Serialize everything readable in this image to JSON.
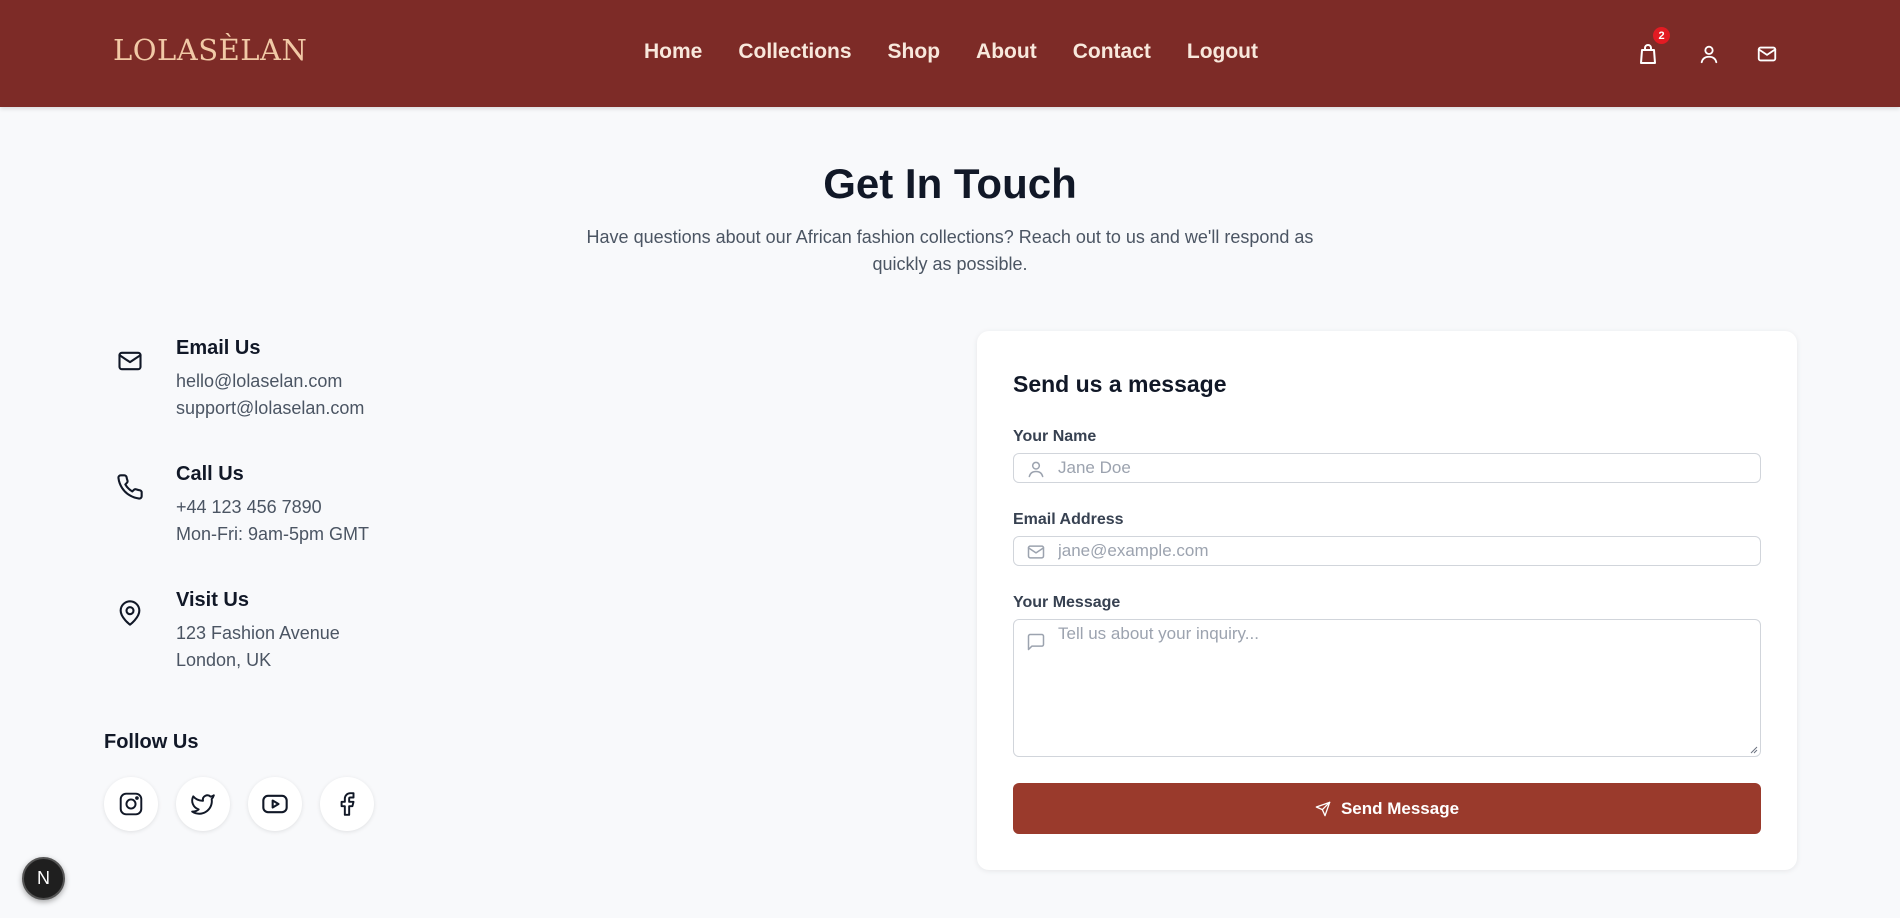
{
  "header": {
    "logo": "LOLASÈLAN",
    "nav": [
      "Home",
      "Collections",
      "Shop",
      "About",
      "Contact",
      "Logout"
    ],
    "cart_count": "2"
  },
  "hero": {
    "title": "Get In Touch",
    "subtitle": "Have questions about our African fashion collections? Reach out to us and we'll respond as quickly as possible."
  },
  "contact": {
    "email": {
      "title": "Email Us",
      "lines": [
        "hello@lolaselan.com",
        "support@lolaselan.com"
      ]
    },
    "phone": {
      "title": "Call Us",
      "lines": [
        "+44 123 456 7890",
        "Mon-Fri: 9am-5pm GMT"
      ]
    },
    "visit": {
      "title": "Visit Us",
      "lines": [
        "123 Fashion Avenue",
        "London, UK"
      ]
    }
  },
  "follow": {
    "title": "Follow Us",
    "icons": [
      "instagram-icon",
      "twitter-icon",
      "youtube-icon",
      "facebook-icon"
    ]
  },
  "form": {
    "title": "Send us a message",
    "name_label": "Your Name",
    "name_placeholder": "Jane Doe",
    "email_label": "Email Address",
    "email_placeholder": "jane@example.com",
    "message_label": "Your Message",
    "message_placeholder": "Tell us about your inquiry...",
    "submit_label": "Send Message"
  },
  "dev_badge": "N",
  "colors": {
    "header_bg": "#7d2b27",
    "logo": "#f1c9a6",
    "button_bg": "#9a3a2c",
    "badge": "#e31b23",
    "page_bg": "#f8f9fb"
  }
}
